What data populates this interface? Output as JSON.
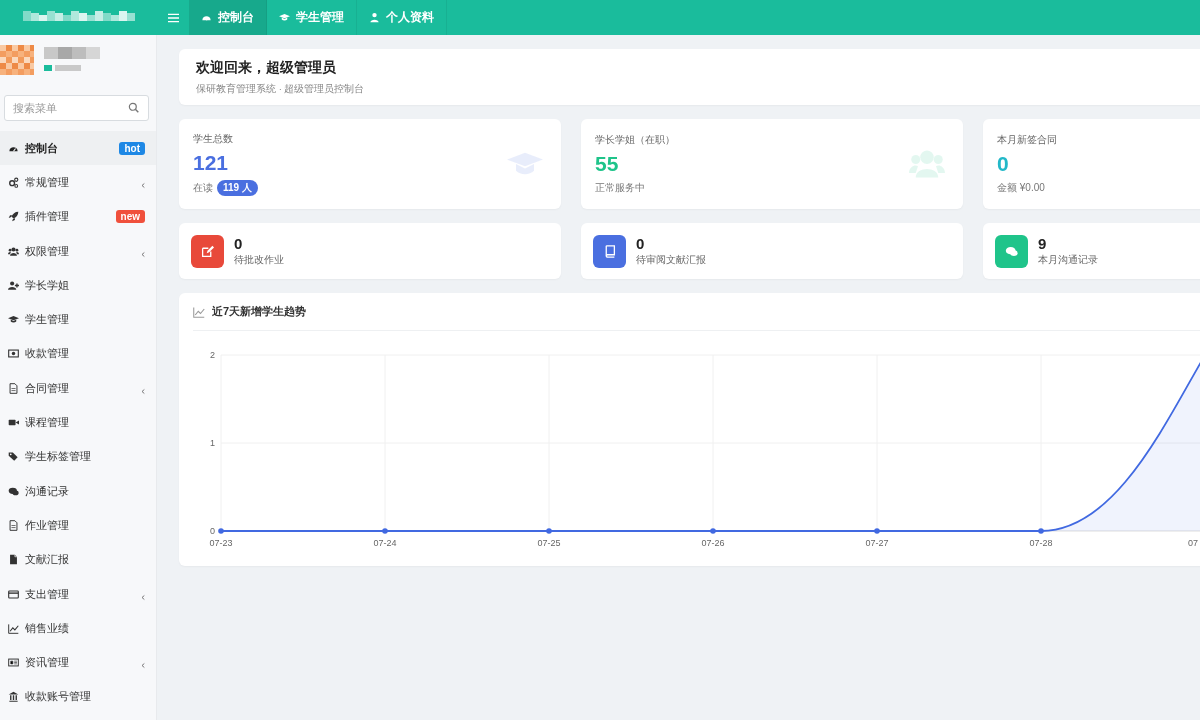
{
  "topbar": {
    "tabs": [
      {
        "label": "控制台",
        "selected": true
      },
      {
        "label": "学生管理",
        "selected": false
      },
      {
        "label": "个人资料",
        "selected": false
      }
    ]
  },
  "sidebar": {
    "search": {
      "placeholder": "搜索菜单"
    },
    "items": [
      {
        "label": "控制台",
        "selected": true,
        "has_submenu": false,
        "badge": {
          "text": "hot",
          "color": "#1e88e5"
        }
      },
      {
        "label": "常规管理",
        "selected": false,
        "has_submenu": true
      },
      {
        "label": "插件管理",
        "selected": false,
        "has_submenu": false,
        "badge": {
          "text": "new",
          "color": "#f0503c"
        }
      },
      {
        "label": "权限管理",
        "selected": false,
        "has_submenu": true
      },
      {
        "label": "学长学姐",
        "selected": false,
        "has_submenu": false
      },
      {
        "label": "学生管理",
        "selected": false,
        "has_submenu": false
      },
      {
        "label": "收款管理",
        "selected": false,
        "has_submenu": false
      },
      {
        "label": "合同管理",
        "selected": false,
        "has_submenu": true
      },
      {
        "label": "课程管理",
        "selected": false,
        "has_submenu": false
      },
      {
        "label": "学生标签管理",
        "selected": false,
        "has_submenu": false
      },
      {
        "label": "沟通记录",
        "selected": false,
        "has_submenu": false
      },
      {
        "label": "作业管理",
        "selected": false,
        "has_submenu": false
      },
      {
        "label": "文献汇报",
        "selected": false,
        "has_submenu": false
      },
      {
        "label": "支出管理",
        "selected": false,
        "has_submenu": true
      },
      {
        "label": "销售业绩",
        "selected": false,
        "has_submenu": false
      },
      {
        "label": "资讯管理",
        "selected": false,
        "has_submenu": true
      },
      {
        "label": "收款账号管理",
        "selected": false,
        "has_submenu": false
      }
    ]
  },
  "welcome": {
    "title": "欢迎回来，超级管理员",
    "subtitle": "保研教育管理系统 · 超级管理员控制台"
  },
  "stats": [
    {
      "label": "学生总数",
      "value": "121",
      "color": "#4a6fe0",
      "note": "在读",
      "badge": "119 人"
    },
    {
      "label": "学长学姐（在职）",
      "value": "55",
      "color": "#1fc48a",
      "note": "正常服务中"
    },
    {
      "label": "本月新签合同",
      "value": "0",
      "color": "#22b8c8",
      "note": "金额 ¥0.00"
    }
  ],
  "tasks": [
    {
      "value": "0",
      "label": "待批改作业",
      "color": "#e8493a"
    },
    {
      "value": "0",
      "label": "待审阅文献汇报",
      "color": "#4a6fe0"
    },
    {
      "value": "9",
      "label": "本月沟通记录",
      "color": "#1fc48a"
    }
  ],
  "trend": {
    "chart_data": {
      "type": "area",
      "title": "近7天新增学生趋势",
      "categories": [
        "07-23",
        "07-24",
        "07-25",
        "07-26",
        "07-27",
        "07-28",
        "07"
      ],
      "series": [
        {
          "color": "#4169e1",
          "values": [
            0,
            0,
            0,
            0,
            0,
            0,
            2
          ]
        }
      ],
      "yticks": [
        0,
        1,
        2
      ],
      "ylim": [
        0,
        2
      ],
      "grid": true
    }
  }
}
